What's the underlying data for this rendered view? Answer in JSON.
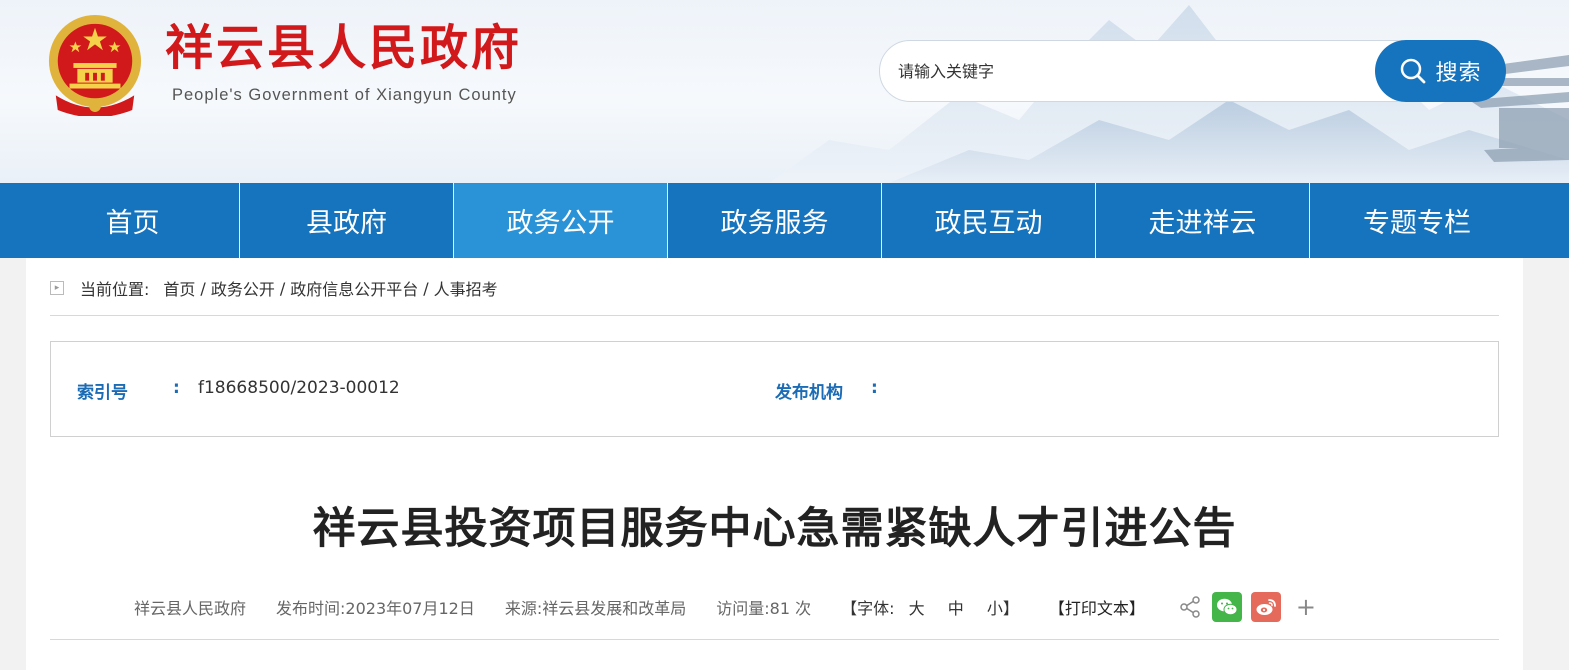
{
  "header": {
    "site_title": "祥云县人民政府",
    "site_subtitle": "People's Government of Xiangyun County",
    "search": {
      "placeholder": "请输入关键字",
      "button_label": "搜索"
    }
  },
  "nav": {
    "items": [
      {
        "label": "首页"
      },
      {
        "label": "县政府"
      },
      {
        "label": "政务公开",
        "active": true
      },
      {
        "label": "政务服务"
      },
      {
        "label": "政民互动"
      },
      {
        "label": "走进祥云"
      },
      {
        "label": "专题专栏"
      }
    ]
  },
  "breadcrumb": {
    "label": "当前位置:",
    "items": [
      "首页",
      "政务公开",
      "政府信息公开平台",
      "人事招考"
    ],
    "separator": "/"
  },
  "info": {
    "index_label": "索引号",
    "index_value": "f18668500/2023-00012",
    "publisher_label": "发布机构",
    "publisher_value": "",
    "colon": ":"
  },
  "article": {
    "title": "祥云县投资项目服务中心急需紧缺人才引进公告",
    "meta": {
      "author": "祥云县人民政府",
      "publish_time": "发布时间:2023年07月12日",
      "source": "来源:祥云县发展和改革局",
      "views": "访问量:81 次",
      "font_label": "【字体:",
      "font_large": "大",
      "font_medium": "中",
      "font_small": "小】",
      "print_label": "【打印文本】"
    }
  },
  "colors": {
    "brand_blue": "#1673bd",
    "nav_active": "#2a93d8",
    "title_red": "#d1191b",
    "label_blue": "#1b6bb5",
    "wechat_green": "#43b549",
    "weibo_red": "#e66a5b"
  },
  "icons": [
    "national-emblem-icon",
    "search-icon",
    "breadcrumb-arrow-icon",
    "share-icon",
    "wechat-icon",
    "weibo-icon",
    "plus-icon"
  ]
}
